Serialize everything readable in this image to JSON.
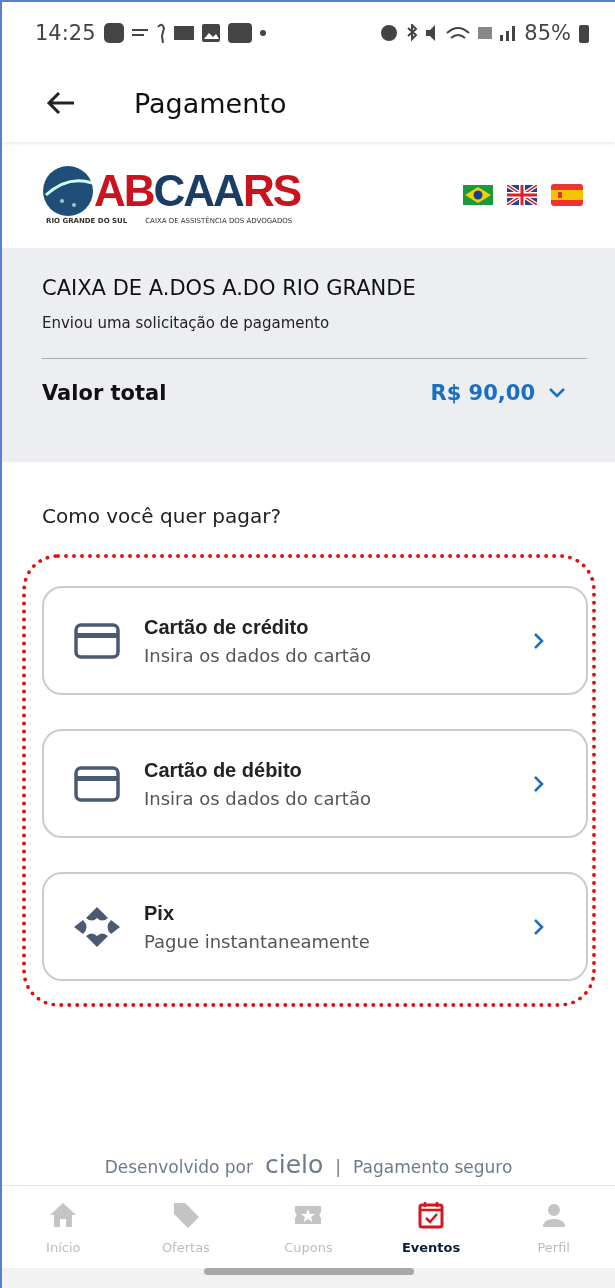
{
  "status_bar": {
    "time": "14:25",
    "battery": "85%"
  },
  "header": {
    "title": "Pagamento"
  },
  "logo": {
    "part_1": "AB",
    "part_2": "CAA",
    "part_3": "RS",
    "subtitle_1": "RIO GRANDE DO SUL",
    "subtitle_2": "CAIXA DE ASSISTÊNCIA DOS ADVOGADOS"
  },
  "languages": [
    {
      "kind": "br"
    },
    {
      "kind": "uk"
    },
    {
      "kind": "es"
    }
  ],
  "merchant": {
    "name": "CAIXA DE A.DOS A.DO RIO GRANDE",
    "message": "Enviou uma solicitação de pagamento",
    "total_label": "Valor total",
    "total_value": "R$ 90,00",
    "expanded": false
  },
  "question": "Como você quer pagar?",
  "methods": [
    {
      "kind": "card",
      "title": "Cartão de crédito",
      "subtitle": "Insira os dados do cartão"
    },
    {
      "kind": "card",
      "title": "Cartão de débito",
      "subtitle": "Insira os dados do cartão"
    },
    {
      "kind": "pix",
      "title": "Pix",
      "subtitle": "Pague instantaneamente"
    }
  ],
  "footer": {
    "prefix": "Desenvolvido por",
    "brand": "cielo",
    "separator": "|",
    "suffix": "Pagamento seguro"
  },
  "nav": [
    {
      "kind": "home",
      "label": "Início",
      "selected": false
    },
    {
      "kind": "tag",
      "label": "Ofertas",
      "selected": false
    },
    {
      "kind": "ticket",
      "label": "Cupons",
      "selected": false
    },
    {
      "kind": "calendar",
      "label": "Eventos",
      "selected": true
    },
    {
      "kind": "person",
      "label": "Perfil",
      "selected": false
    }
  ]
}
